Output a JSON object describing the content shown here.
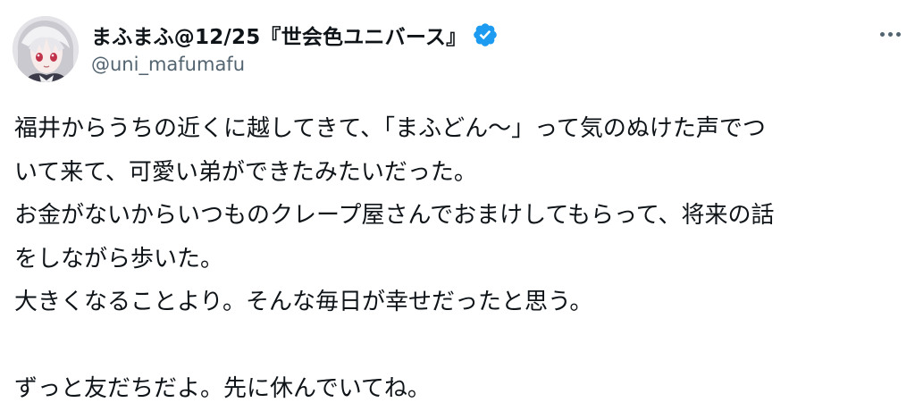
{
  "author": {
    "display_name": "まふまふ@12/25『世会色ユニバース』",
    "handle": "@uni_mafumafu",
    "verified": true
  },
  "icons": {
    "avatar": "avatar-image",
    "verified": "verified-badge-icon",
    "more": "more-options-icon"
  },
  "colors": {
    "verified_blue": "#1d9bf0",
    "text": "#0f1419",
    "secondary": "#536471"
  },
  "tweet": {
    "lines": [
      "福井からうちの近くに越してきて、「まふどん〜」って気のぬけた声でつ",
      "いて来て、可愛い弟ができたみたいだった。",
      "お金がないからいつものクレープ屋さんでおまけしてもらって、将来の話",
      "をしながら歩いた。",
      "大きくなることより。そんな毎日が幸せだったと思う。",
      "",
      "ずっと友だちだよ。先に休んでいてね。"
    ]
  }
}
